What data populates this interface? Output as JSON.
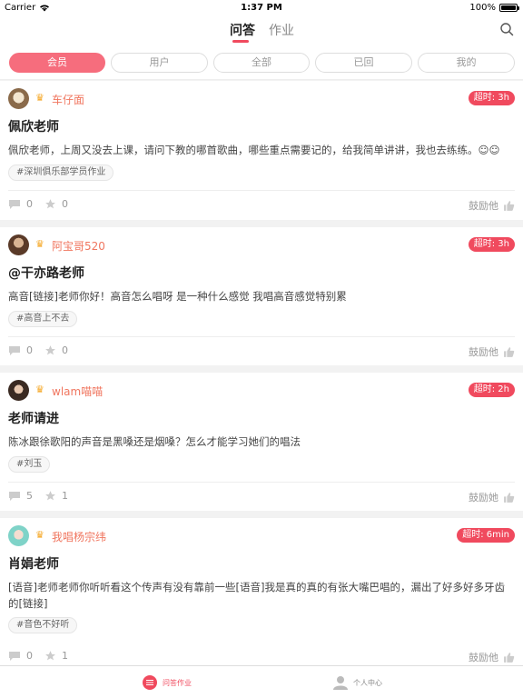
{
  "status_bar": {
    "carrier": "Carrier",
    "time": "1:37 PM",
    "battery": "100%"
  },
  "nav": {
    "tabs": [
      {
        "label": "问答",
        "active": true
      },
      {
        "label": "作业",
        "active": false
      }
    ]
  },
  "filters": [
    {
      "label": "会员",
      "active": true
    },
    {
      "label": "用户",
      "active": false
    },
    {
      "label": "全部",
      "active": false
    },
    {
      "label": "已回",
      "active": false
    },
    {
      "label": "我的",
      "active": false
    }
  ],
  "posts": [
    {
      "user": "车仔面",
      "badge": "超时: 3h",
      "title": "佩欣老师",
      "body": "佩欣老师，上周又没去上课，请问下教的哪首歌曲，哪些重点需要记的，给我简单讲讲，我也去练练。☺☺",
      "tag": "#深圳俱乐部学员作业",
      "comments": "0",
      "likes": "0",
      "encourage": "鼓励他"
    },
    {
      "user": "阿宝哥520",
      "badge": "超时: 3h",
      "title": "@干亦路老师",
      "body": "高音[链接]老师你好！高音怎么唱呀 是一种什么感觉 我唱高音感觉特别累",
      "tag": "#高音上不去",
      "comments": "0",
      "likes": "0",
      "encourage": "鼓励他"
    },
    {
      "user": "wlam喵喵",
      "badge": "超时: 2h",
      "title": "老师请进",
      "body": "陈冰跟徐歌阳的声音是黑嗓还是烟嗓？怎么才能学习她们的唱法",
      "tag": "#刘玉",
      "comments": "5",
      "likes": "1",
      "encourage": "鼓励她"
    },
    {
      "user": "我唱杨宗纬",
      "badge": "超时: 6min",
      "title": "肖娟老师",
      "body": "[语音]老师老师你听听看这个传声有没有靠前一些[语音]我是真的真的有张大嘴巴唱的，漏出了好多好多牙齿的[链接]",
      "tag": "#音色不好听",
      "comments": "0",
      "likes": "1",
      "encourage": "鼓励他"
    }
  ],
  "tabbar": [
    {
      "label": "问答作业",
      "active": true,
      "icon": "list-icon"
    },
    {
      "label": "个人中心",
      "active": false,
      "icon": "person-icon"
    }
  ],
  "colors": {
    "accent": "#f04a5e",
    "username": "#f0765f",
    "crown": "#f5a623"
  }
}
